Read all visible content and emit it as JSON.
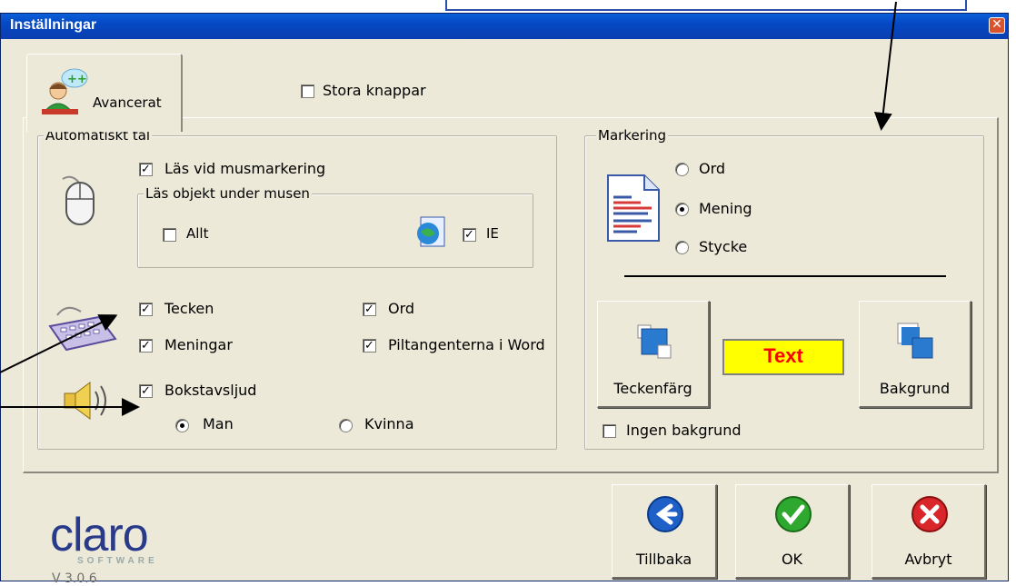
{
  "window": {
    "title": "Inställningar",
    "close_glyph": "✕"
  },
  "tab": {
    "label": "Avancerat"
  },
  "large_buttons": {
    "label": "Stora knappar",
    "checked": false
  },
  "auto_speech": {
    "legend": "Automatiskt tal",
    "read_mouse_selection": {
      "label": "Läs vid musmarkering",
      "checked": true
    },
    "under_mouse": {
      "legend": "Läs objekt under musen",
      "all": {
        "label": "Allt",
        "checked": false
      },
      "ie": {
        "label": "IE",
        "checked": true
      }
    },
    "chars": {
      "label": "Tecken",
      "checked": true
    },
    "words": {
      "label": "Ord",
      "checked": true
    },
    "sentences": {
      "label": "Meningar",
      "checked": true
    },
    "arrow_keys": {
      "label": "Piltangenterna i Word",
      "checked": true
    },
    "letter_sounds": {
      "label": "Bokstavsljud",
      "checked": true
    },
    "voice_man": {
      "label": "Man",
      "selected": true
    },
    "voice_woman": {
      "label": "Kvinna",
      "selected": false
    }
  },
  "marking": {
    "legend": "Markering",
    "word": {
      "label": "Ord",
      "selected": false
    },
    "sentence": {
      "label": "Mening",
      "selected": true
    },
    "paragraph": {
      "label": "Stycke",
      "selected": false
    },
    "text_color_button": "Teckenfärg",
    "sample_text": "Text",
    "background_button": "Bakgrund",
    "no_background": {
      "label": "Ingen bakgrund",
      "checked": false
    }
  },
  "footer": {
    "logo": "claro",
    "logo_sub": "SOFTWARE",
    "version": "V 3.0.6",
    "back_button": "Tillbaka",
    "ok_button": "OK",
    "cancel_button": "Avbryt"
  },
  "colors": {
    "title_bar": "#0a4fc8",
    "sample_bg": "#ffff00",
    "sample_fg": "#ff0000",
    "back_icon": "#1f5fc8",
    "ok_icon": "#2ea82e",
    "cancel_icon": "#d8262a"
  }
}
